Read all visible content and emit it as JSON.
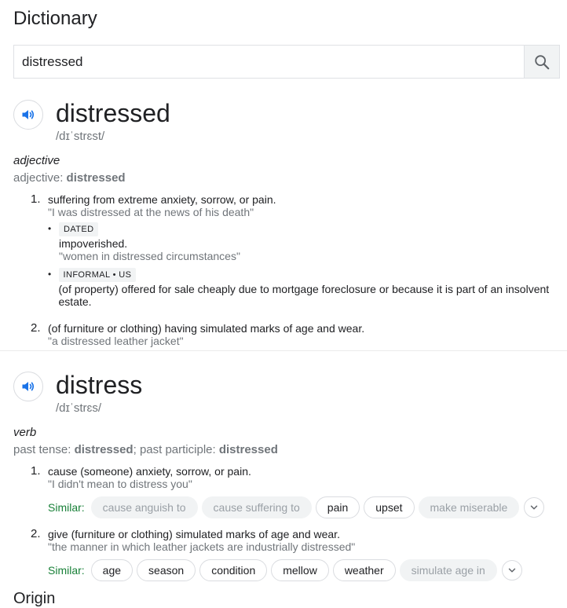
{
  "title": "Dictionary",
  "search": {
    "value": "distressed",
    "icon": "search-icon"
  },
  "entries": [
    {
      "headword": "distressed",
      "phonetic": "/dɪˈstrɛst/",
      "pos": "adjective",
      "forms_label": "adjective: ",
      "forms_value": "distressed",
      "senses": [
        {
          "num": "1.",
          "def": "suffering from extreme anxiety, sorrow, or pain.",
          "example": "\"I was distressed at the news of his death\"",
          "subs": [
            {
              "tag": "DATED",
              "def": "impoverished.",
              "example": "\"women in distressed circumstances\""
            },
            {
              "tag": "INFORMAL • US",
              "def": "(of property) offered for sale cheaply due to mortgage foreclosure or because it is part of an insolvent estate.",
              "example": ""
            }
          ]
        },
        {
          "num": "2.",
          "def": "(of furniture or clothing) having simulated marks of age and wear.",
          "example": "\"a distressed leather jacket\""
        }
      ]
    },
    {
      "headword": "distress",
      "phonetic": "/dɪˈstrɛs/",
      "pos": "verb",
      "forms": {
        "past_tense_label": "past tense: ",
        "past_tense": "distressed",
        "sep": "; past participle: ",
        "past_participle": "distressed"
      },
      "senses": [
        {
          "num": "1.",
          "def": "cause (someone) anxiety, sorrow, or pain.",
          "example": "\"I didn't mean to distress you\"",
          "similar_label": "Similar:",
          "similar": [
            {
              "text": "cause anguish to",
              "active": false
            },
            {
              "text": "cause suffering to",
              "active": false
            },
            {
              "text": "pain",
              "active": true
            },
            {
              "text": "upset",
              "active": true
            },
            {
              "text": "make miserable",
              "active": false
            }
          ]
        },
        {
          "num": "2.",
          "def": "give (furniture or clothing) simulated marks of age and wear.",
          "example": "\"the manner in which leather jackets are industrially distressed\"",
          "similar_label": "Similar:",
          "similar": [
            {
              "text": "age",
              "active": true
            },
            {
              "text": "season",
              "active": true
            },
            {
              "text": "condition",
              "active": true
            },
            {
              "text": "mellow",
              "active": true
            },
            {
              "text": "weather",
              "active": true
            },
            {
              "text": "simulate age in",
              "active": false
            }
          ]
        }
      ]
    }
  ],
  "cut_off_text": "Origin",
  "colors": {
    "accent_blue": "#1a73e8",
    "similar_green": "#188038",
    "muted_gray": "#70757a"
  }
}
